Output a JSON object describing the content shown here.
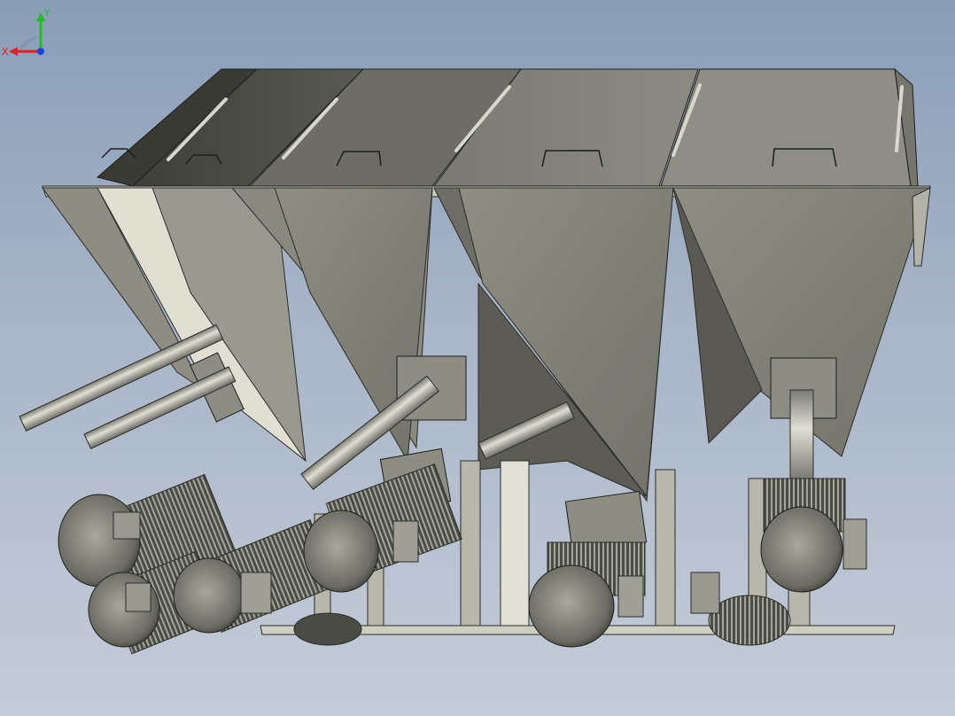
{
  "viewport": {
    "background_top": "#8a9db8",
    "background_bottom": "#c4ccd8",
    "model": {
      "hoppers": 5,
      "motors": 6
    }
  },
  "triad": {
    "x_label": "X",
    "y_label": "Y",
    "x_color": "#e02020",
    "y_color": "#20c020",
    "z_color": "#2040e0"
  }
}
